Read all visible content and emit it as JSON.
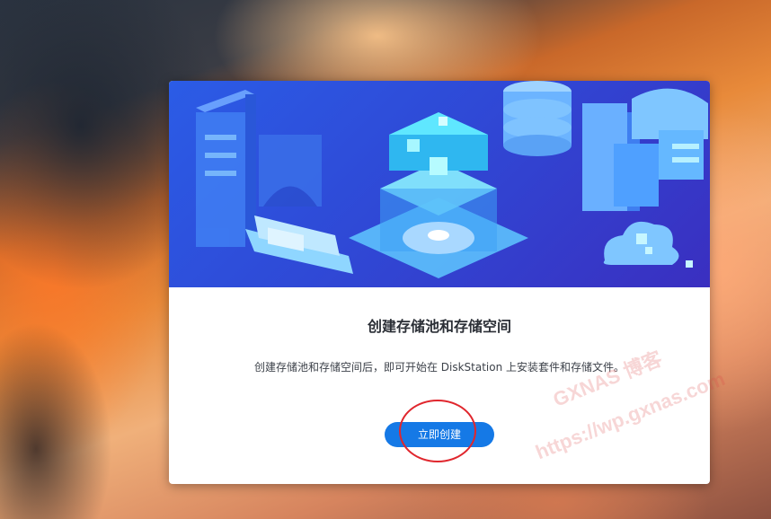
{
  "dialog": {
    "title": "创建存储池和存储空间",
    "description": "创建存储池和存储空间后，即可开始在 DiskStation 上安装套件和存储文件。",
    "create_button_label": "立即创建"
  },
  "watermark": {
    "line1": "GXNAS 博客",
    "line2": "https://wp.gxnas.com"
  },
  "colors": {
    "accent": "#1579e6",
    "hero_blue": "#2f49d6",
    "annotation": "#e0262d"
  },
  "icons": {
    "hero": "storage-illustration"
  }
}
